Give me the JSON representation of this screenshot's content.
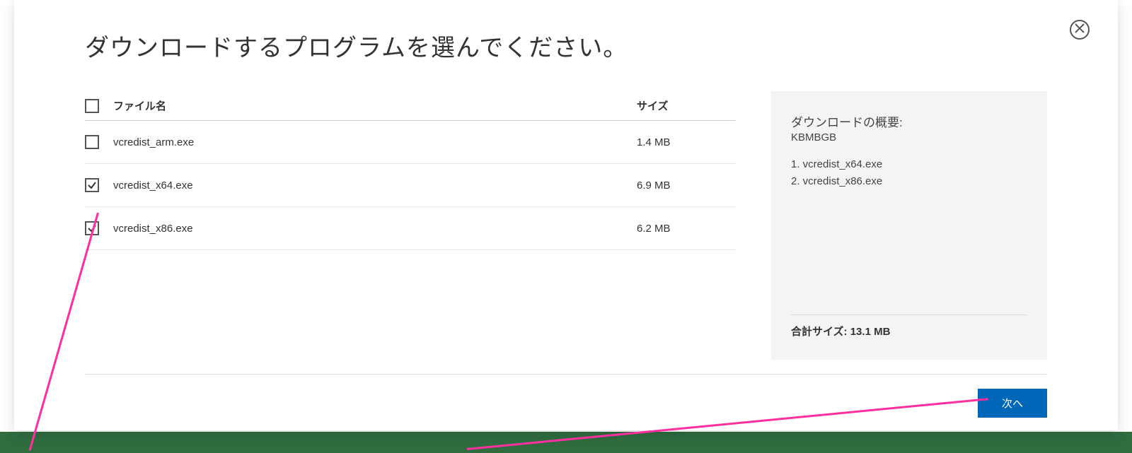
{
  "dialog": {
    "title": "ダウンロードするプログラムを選んでください。",
    "columns": {
      "filename": "ファイル名",
      "size": "サイズ"
    },
    "files": [
      {
        "name": "vcredist_arm.exe",
        "size": "1.4 MB",
        "checked": false
      },
      {
        "name": "vcredist_x64.exe",
        "size": "6.9 MB",
        "checked": true
      },
      {
        "name": "vcredist_x86.exe",
        "size": "6.2 MB",
        "checked": true
      }
    ],
    "select_all_checked": false,
    "summary": {
      "title": "ダウンロードの概要:",
      "units": "KBMBGB",
      "items": [
        "1. vcredist_x64.exe",
        "2. vcredist_x86.exe"
      ],
      "total_label": "合計サイズ:",
      "total_value": "13.1 MB"
    },
    "buttons": {
      "next": "次へ"
    }
  }
}
